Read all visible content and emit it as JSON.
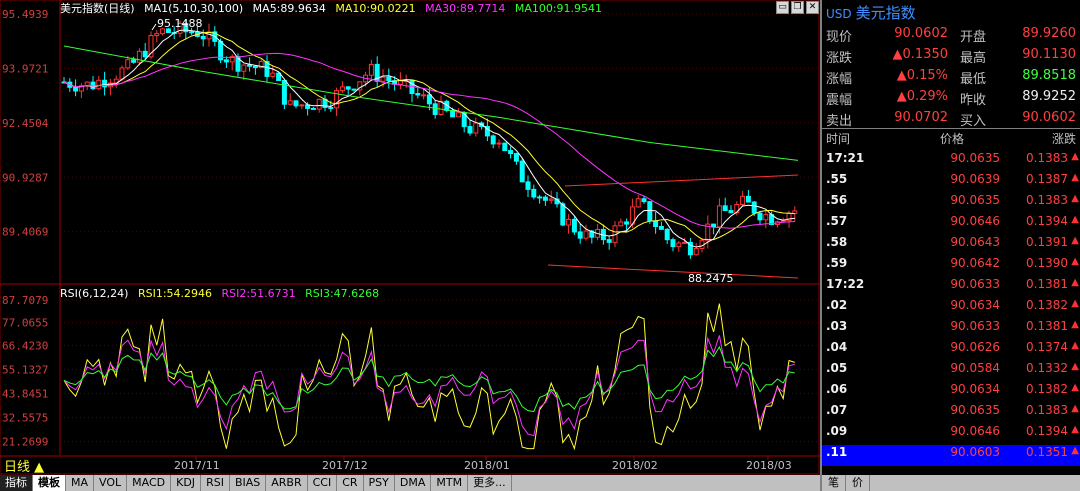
{
  "main": {
    "title": "美元指数(日线)",
    "ma_label": "MA1(5,10,30,100)",
    "ma5": "MA5:89.9634",
    "ma10": "MA10:90.0221",
    "ma30": "MA30:89.7714",
    "ma100": "MA100:91.9541",
    "price_ticks": [
      "95.4939",
      "93.9721",
      "92.4504",
      "90.9287",
      "89.4069"
    ],
    "high_marker": "95.1488",
    "low_marker": "88.2475",
    "rsi_label": "RSI(6,12,24)",
    "rsi1": "RSI1:54.2946",
    "rsi2": "RSI2:51.6731",
    "rsi3": "RSI3:47.6268",
    "rsi_ticks": [
      "87.7079",
      "77.0655",
      "66.4230",
      "55.1327",
      "43.8451",
      "32.5575",
      "21.2699"
    ],
    "dates": [
      "2017/11",
      "2017/12",
      "2018/01",
      "2018/02",
      "2018/03"
    ],
    "period": "日线",
    "colors": {
      "ma5": "#ffffff",
      "ma10": "#ffff33",
      "ma30": "#ff33ff",
      "ma100": "#33ff33",
      "up": "#ff3333",
      "down": "#00ffff"
    }
  },
  "tabs": [
    "指标",
    "模板",
    "MA",
    "VOL",
    "MACD",
    "KDJ",
    "RSI",
    "BIAS",
    "ARBR",
    "CCI",
    "CR",
    "PSY",
    "DMA",
    "MTM",
    "更多..."
  ],
  "side": {
    "code": "USD",
    "name": "美元指数",
    "quotes": [
      {
        "l1": "现价",
        "v1": "90.0602",
        "c1": "red",
        "l2": "开盘",
        "v2": "89.9260",
        "c2": "red"
      },
      {
        "l1": "涨跌",
        "v1": "▲0.1350",
        "c1": "red",
        "l2": "最高",
        "v2": "90.1130",
        "c2": "red"
      },
      {
        "l1": "涨幅",
        "v1": "▲0.15%",
        "c1": "red",
        "l2": "最低",
        "v2": "89.8518",
        "c2": "green"
      },
      {
        "l1": "震幅",
        "v1": "▲0.29%",
        "c1": "red",
        "l2": "昨收",
        "v2": "89.9252",
        "c2": "white"
      },
      {
        "l1": "卖出",
        "v1": "90.0702",
        "c1": "red",
        "l2": "买入",
        "v2": "90.0602",
        "c2": "red"
      }
    ],
    "tick_headers": {
      "time": "时间",
      "price": "价格",
      "change": "涨跌"
    },
    "ticks": [
      {
        "t": "17:21",
        "p": "90.0635",
        "c": "0.1383"
      },
      {
        "t": ".55",
        "p": "90.0639",
        "c": "0.1387"
      },
      {
        "t": ".56",
        "p": "90.0635",
        "c": "0.1383"
      },
      {
        "t": ".57",
        "p": "90.0646",
        "c": "0.1394"
      },
      {
        "t": ".58",
        "p": "90.0643",
        "c": "0.1391"
      },
      {
        "t": ".59",
        "p": "90.0642",
        "c": "0.1390"
      },
      {
        "t": "17:22",
        "p": "90.0633",
        "c": "0.1381"
      },
      {
        "t": ".02",
        "p": "90.0634",
        "c": "0.1382"
      },
      {
        "t": ".03",
        "p": "90.0633",
        "c": "0.1381"
      },
      {
        "t": ".04",
        "p": "90.0626",
        "c": "0.1374"
      },
      {
        "t": ".05",
        "p": "90.0584",
        "c": "0.1332"
      },
      {
        "t": ".06",
        "p": "90.0634",
        "c": "0.1382"
      },
      {
        "t": ".07",
        "p": "90.0635",
        "c": "0.1383"
      },
      {
        "t": ".09",
        "p": "90.0646",
        "c": "0.1394"
      },
      {
        "t": ".11",
        "p": "90.0603",
        "c": "0.1351"
      }
    ],
    "bottom_tabs": [
      "笔",
      "价"
    ]
  }
}
